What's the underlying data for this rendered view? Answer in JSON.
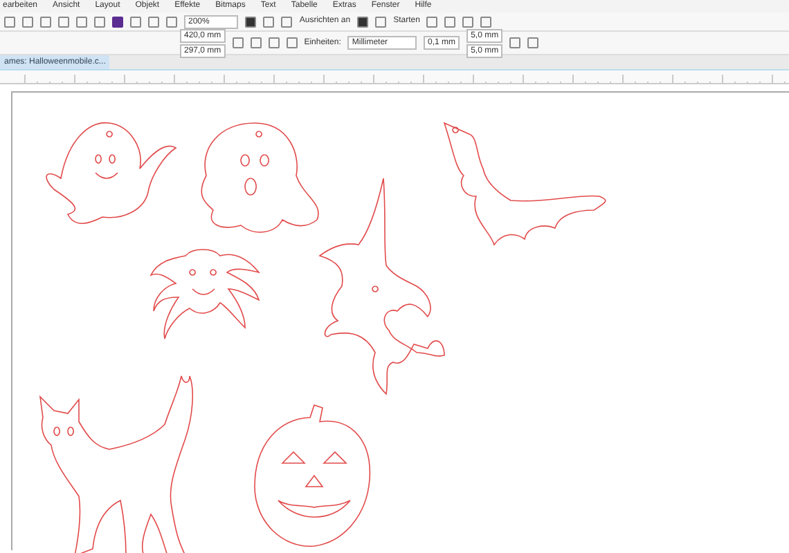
{
  "menu_bar": {
    "items": [
      "earbeiten",
      "Ansicht",
      "Layout",
      "Objekt",
      "Effekte",
      "Bitmaps",
      "Text",
      "Tabelle",
      "Extras",
      "Fenster",
      "Hilfe"
    ]
  },
  "standard_toolbar": {
    "zoom": "200%",
    "snap": "Ausrichten an",
    "launch": "Starten"
  },
  "property_bar": {
    "width": "420,0 mm",
    "height": "297,0 mm",
    "units_label": "Einheiten:",
    "units": "Millimeter",
    "nudge": "0,1 mm",
    "dup_x": "5,0 mm",
    "dup_y": "5,0 mm"
  },
  "document_tabs": [
    {
      "label": "ames: Halloweenmobile.c...",
      "selected": true
    }
  ],
  "shapes": [
    {
      "kind": "ghost"
    },
    {
      "kind": "ghost2"
    },
    {
      "kind": "bat"
    },
    {
      "kind": "witch"
    },
    {
      "kind": "spider"
    },
    {
      "kind": "cat"
    },
    {
      "kind": "pumpkin"
    }
  ]
}
